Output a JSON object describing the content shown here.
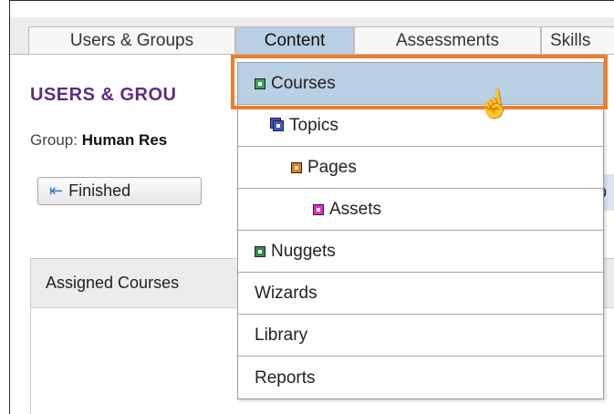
{
  "tabs": [
    {
      "label": "Users & Groups"
    },
    {
      "label": "Content"
    },
    {
      "label": "Assessments"
    },
    {
      "label": "Skills"
    }
  ],
  "page": {
    "title": "USERS & GROU",
    "group_label": "Group:",
    "group_value": "Human Res"
  },
  "finished_button": {
    "label": "Finished"
  },
  "side_strip_text": "b",
  "panel": {
    "header": "Assigned Courses"
  },
  "menu": {
    "items": [
      {
        "label": "Courses",
        "icon": "course-icon",
        "selected": true
      },
      {
        "label": "Topics",
        "icon": "topic-icon"
      },
      {
        "label": "Pages",
        "icon": "page-icon"
      },
      {
        "label": "Assets",
        "icon": "asset-icon"
      },
      {
        "label": "Nuggets",
        "icon": "nugget-icon"
      },
      {
        "label": "Wizards"
      },
      {
        "label": "Library"
      },
      {
        "label": "Reports"
      }
    ]
  },
  "colors": {
    "accent_title": "#5e2d7f",
    "active_tab": "#b9cfe4",
    "highlight_border": "#ef7d2b"
  }
}
